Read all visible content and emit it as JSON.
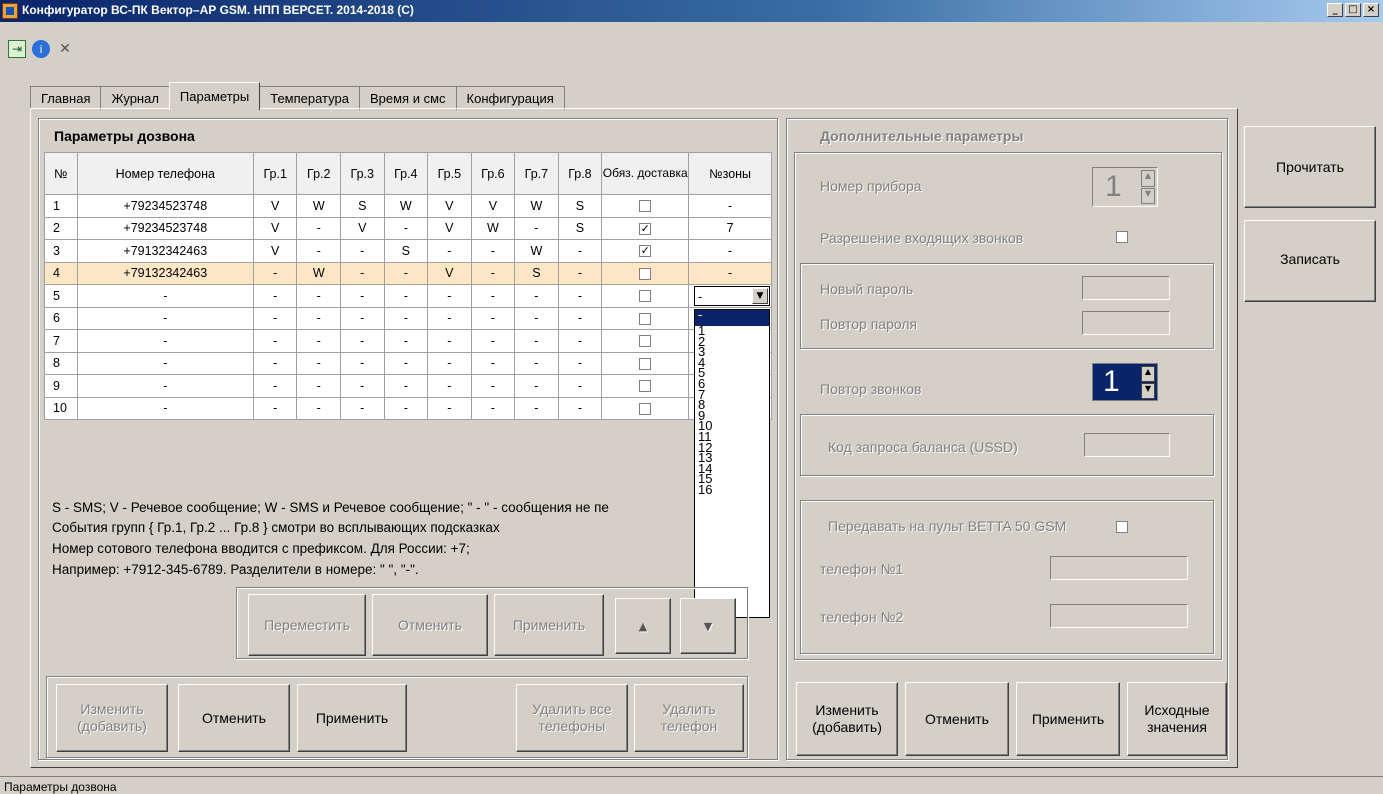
{
  "window": {
    "title": "Конфигуратор ВС-ПК Вектор–АР GSM. НПП ВЕРСЕТ. 2014-2018 (С)",
    "min": "_",
    "max": "□",
    "close": "×"
  },
  "toolbar": {
    "icons": [
      "exit-icon",
      "info-icon",
      "tools-icon"
    ]
  },
  "tabs": [
    {
      "label": "Главная"
    },
    {
      "label": "Журнал"
    },
    {
      "label": "Параметры"
    },
    {
      "label": "Температура"
    },
    {
      "label": "Время и смс"
    },
    {
      "label": "Конфигурация"
    }
  ],
  "dial": {
    "title": "Параметры дозвона",
    "headers": [
      "№",
      "Номер телефона",
      "Гр.1",
      "Гр.2",
      "Гр.3",
      "Гр.4",
      "Гр.5",
      "Гр.6",
      "Гр.7",
      "Гр.8",
      "Обяз. доставка",
      "№зоны"
    ],
    "rows": [
      {
        "n": "1",
        "phone": "+79234523748",
        "g": [
          "V",
          "W",
          "S",
          "W",
          "V",
          "V",
          "W",
          "S"
        ],
        "chk": false,
        "zone": "-"
      },
      {
        "n": "2",
        "phone": "+79234523748",
        "g": [
          "V",
          "-",
          "V",
          "-",
          "V",
          "W",
          "-",
          "S"
        ],
        "chk": true,
        "zone": "7"
      },
      {
        "n": "3",
        "phone": "+79132342463",
        "g": [
          "V",
          "-",
          "-",
          "S",
          "-",
          "-",
          "W",
          "-"
        ],
        "chk": true,
        "zone": "-"
      },
      {
        "n": "4",
        "phone": "+79132342463",
        "g": [
          "-",
          "W",
          "-",
          "-",
          "V",
          "-",
          "S",
          "-"
        ],
        "chk": false,
        "zone": "-"
      },
      {
        "n": "5",
        "phone": "-",
        "g": [
          "-",
          "-",
          "-",
          "-",
          "-",
          "-",
          "-",
          "-"
        ],
        "chk": false,
        "zone": ""
      },
      {
        "n": "6",
        "phone": "-",
        "g": [
          "-",
          "-",
          "-",
          "-",
          "-",
          "-",
          "-",
          "-"
        ],
        "chk": false,
        "zone": ""
      },
      {
        "n": "7",
        "phone": "-",
        "g": [
          "-",
          "-",
          "-",
          "-",
          "-",
          "-",
          "-",
          "-"
        ],
        "chk": false,
        "zone": ""
      },
      {
        "n": "8",
        "phone": "-",
        "g": [
          "-",
          "-",
          "-",
          "-",
          "-",
          "-",
          "-",
          "-"
        ],
        "chk": false,
        "zone": ""
      },
      {
        "n": "9",
        "phone": "-",
        "g": [
          "-",
          "-",
          "-",
          "-",
          "-",
          "-",
          "-",
          "-"
        ],
        "chk": false,
        "zone": ""
      },
      {
        "n": "10",
        "phone": "-",
        "g": [
          "-",
          "-",
          "-",
          "-",
          "-",
          "-",
          "-",
          "-"
        ],
        "chk": false,
        "zone": ""
      }
    ],
    "zone_select": {
      "value": "-",
      "options": [
        "-",
        "1",
        "2",
        "3",
        "4",
        "5",
        "6",
        "7",
        "8",
        "9",
        "10",
        "11",
        "12",
        "13",
        "14",
        "15",
        "16"
      ]
    },
    "notes": [
      "S - SMS;  V - Речевое сообщение;  W - SMS и Речевое сообщение; \" - \" - сообщения не пе",
      "События групп { Гр.1, Гр.2 ... Гр.8 } смотри во всплывающих подсказках",
      "Номер сотового телефона вводится с префиксом. Для России: +7;",
      "Например: +7912-345-6789. Разделители в номере: \" \", \"-\"."
    ],
    "move_buttons": {
      "move": "Переместить",
      "cancel": "Отменить",
      "apply": "Применить",
      "up": "▲",
      "down": "▼"
    },
    "bottom_buttons": {
      "edit": "Изменить (добавить)",
      "cancel": "Отменить",
      "apply": "Применить",
      "delete_all": "Удалить все телефоны",
      "delete": "Удалить телефон"
    }
  },
  "extra": {
    "title": "Дополнительные параметры",
    "device_label": "Номер прибора",
    "device_value": "1",
    "incoming_label": "Разрешение входящих звонков",
    "new_pass_label": "Новый пароль",
    "repeat_pass_label": "Повтор пароля",
    "repeat_calls_label": "Повтор звонков",
    "repeat_calls_value": "1",
    "ussd_label": "Код запроса баланса (USSD)",
    "betta_label": "Передавать на пульт BETTA 50 GSM",
    "phone1_label": "телефон №1",
    "phone2_label": "телефон №2",
    "buttons": {
      "edit": "Изменить (добавить)",
      "cancel": "Отменить",
      "apply": "Применить",
      "defaults": "Исходные значения"
    }
  },
  "side": {
    "read": "Прочитать",
    "write": "Записать"
  },
  "status": "Параметры дозвона"
}
